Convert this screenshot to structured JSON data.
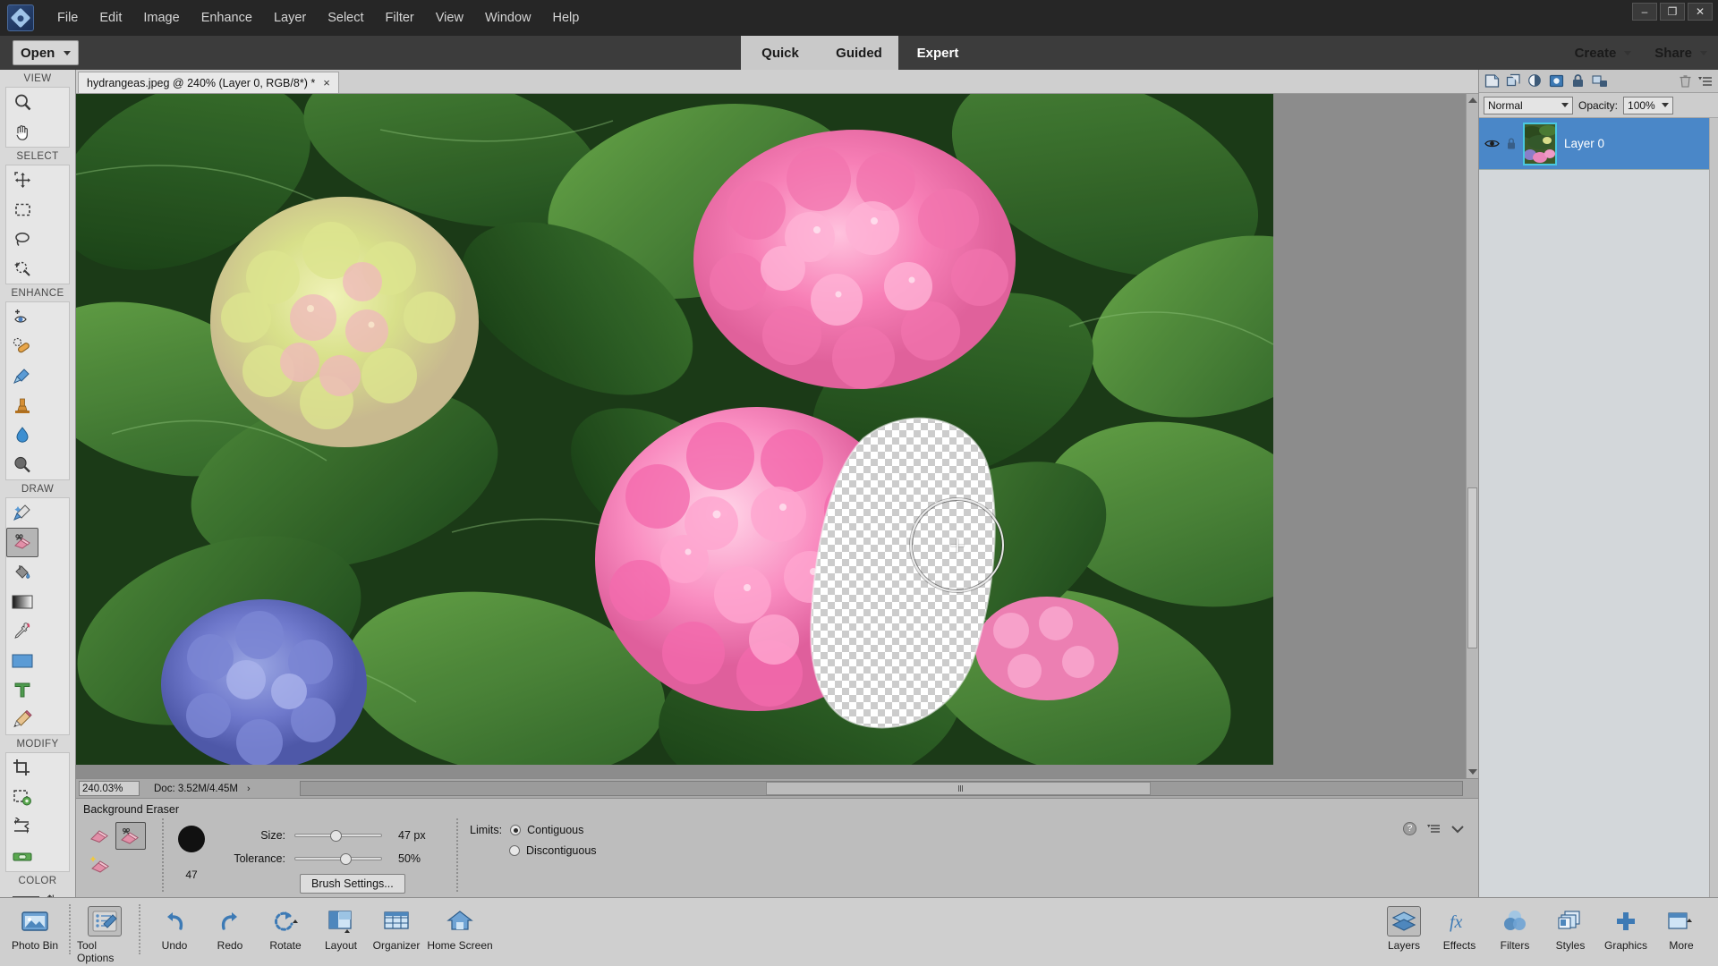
{
  "app": {
    "title": "Adobe Photoshop Elements",
    "logo_icon": "photoshop-elements-logo-icon"
  },
  "menubar": {
    "items": [
      {
        "label": "File"
      },
      {
        "label": "Edit"
      },
      {
        "label": "Image"
      },
      {
        "label": "Enhance"
      },
      {
        "label": "Layer"
      },
      {
        "label": "Select"
      },
      {
        "label": "Filter"
      },
      {
        "label": "View"
      },
      {
        "label": "Window"
      },
      {
        "label": "Help"
      }
    ],
    "window_controls": {
      "minimize": "–",
      "maximize": "❐",
      "close": "✕"
    }
  },
  "modebar": {
    "open_label": "Open",
    "modes": [
      {
        "label": "Quick",
        "active": false
      },
      {
        "label": "Guided",
        "active": false
      },
      {
        "label": "Expert",
        "active": true
      }
    ],
    "create_label": "Create",
    "share_label": "Share"
  },
  "toolbar": {
    "sections": [
      {
        "label": "VIEW",
        "tools": [
          {
            "name": "zoom-tool",
            "icon": "magnifier-icon",
            "selected": false
          },
          {
            "name": "hand-tool",
            "icon": "hand-icon",
            "selected": false
          }
        ]
      },
      {
        "label": "SELECT",
        "tools": [
          {
            "name": "move-tool",
            "icon": "move-arrows-icon",
            "selected": false
          },
          {
            "name": "rectangular-marquee-tool",
            "icon": "dashed-rectangle-icon",
            "selected": false
          },
          {
            "name": "lasso-tool",
            "icon": "lasso-icon",
            "selected": false
          },
          {
            "name": "quick-selection-tool",
            "icon": "magic-selection-icon",
            "selected": false
          }
        ]
      },
      {
        "label": "ENHANCE",
        "tools": [
          {
            "name": "red-eye-removal-tool",
            "icon": "eye-plus-icon",
            "selected": false
          },
          {
            "name": "spot-healing-brush-tool",
            "icon": "healing-bandage-icon",
            "selected": false
          },
          {
            "name": "smart-brush-tool",
            "icon": "blue-brush-icon",
            "selected": false
          },
          {
            "name": "clone-stamp-tool",
            "icon": "stamp-icon",
            "selected": false
          },
          {
            "name": "blur-tool",
            "icon": "water-drop-icon",
            "selected": false
          },
          {
            "name": "sponge-tool",
            "icon": "sponge-icon",
            "selected": false
          }
        ]
      },
      {
        "label": "DRAW",
        "tools": [
          {
            "name": "brush-tool",
            "icon": "paint-brush-icon",
            "selected": false
          },
          {
            "name": "background-eraser-tool",
            "icon": "eraser-scissors-icon",
            "selected": true
          },
          {
            "name": "paint-bucket-tool",
            "icon": "paint-bucket-icon",
            "selected": false
          },
          {
            "name": "gradient-tool",
            "icon": "gradient-swatch-icon",
            "selected": false
          },
          {
            "name": "color-picker-tool",
            "icon": "eyedropper-icon",
            "selected": false
          },
          {
            "name": "custom-shape-tool",
            "icon": "blue-rectangle-icon",
            "selected": false
          },
          {
            "name": "type-tool",
            "icon": "letter-t-icon",
            "selected": false
          },
          {
            "name": "pencil-tool",
            "icon": "pencil-icon",
            "selected": false
          }
        ]
      },
      {
        "label": "MODIFY",
        "tools": [
          {
            "name": "crop-tool",
            "icon": "crop-icon",
            "selected": false
          },
          {
            "name": "recompose-tool",
            "icon": "recompose-gear-icon",
            "selected": false
          },
          {
            "name": "content-aware-move-tool",
            "icon": "move-swap-arrows-icon",
            "selected": false
          },
          {
            "name": "straighten-tool",
            "icon": "level-bubble-icon",
            "selected": false
          }
        ]
      }
    ],
    "color_label": "COLOR",
    "foreground_color": "#000000",
    "background_color": "#ffffff"
  },
  "document": {
    "tab_title": "hydrangeas.jpeg @ 240% (Layer 0, RGB/8*) *",
    "close_glyph": "×"
  },
  "statusbar": {
    "zoom_value": "240.03%",
    "doc_info": "Doc: 3.52M/4.45M",
    "arrow_glyph": "›"
  },
  "tool_options": {
    "title": "Background Eraser",
    "modes": [
      {
        "name": "eraser-mode",
        "icon": "plain-eraser-icon",
        "selected": false
      },
      {
        "name": "background-eraser-mode",
        "icon": "eraser-scissors-icon",
        "selected": true
      },
      {
        "name": "magic-eraser-mode",
        "icon": "magic-eraser-icon",
        "selected": false
      }
    ],
    "brush_preview_value": "47",
    "size_label": "Size:",
    "size_value": "47 px",
    "size_percent": 47,
    "tolerance_label": "Tolerance:",
    "tolerance_value": "50%",
    "tolerance_percent": 50,
    "brush_settings_label": "Brush Settings...",
    "limits_label": "Limits:",
    "limits_options": [
      {
        "label": "Contiguous",
        "selected": true
      },
      {
        "label": "Discontiguous",
        "selected": false
      }
    ],
    "help_icon": "question-mark-icon",
    "menu_icon": "panel-menu-icon",
    "collapse_icon": "chevron-down-icon"
  },
  "layers_panel": {
    "toolbar_icons": [
      {
        "name": "new-layer-icon"
      },
      {
        "name": "duplicate-layer-icon"
      },
      {
        "name": "adjustment-layer-icon"
      },
      {
        "name": "layer-mask-icon"
      },
      {
        "name": "lock-layer-icon"
      },
      {
        "name": "link-layers-icon"
      },
      {
        "name": "delete-layer-trash-icon"
      },
      {
        "name": "panel-options-menu-icon"
      }
    ],
    "blend_mode": "Normal",
    "opacity_label": "Opacity:",
    "opacity_value": "100%",
    "layers": [
      {
        "name": "Layer 0",
        "visible": true,
        "selected": true,
        "visibility_icon": "eye-icon",
        "lock_icon": "lock-icon"
      }
    ]
  },
  "taskbar": {
    "left_items": [
      {
        "label": "Photo Bin",
        "icon": "photo-bin-icon",
        "selected": false
      },
      {
        "label": "Tool Options",
        "icon": "tool-options-icon",
        "selected": true
      },
      {
        "label": "Undo",
        "icon": "undo-arrow-icon",
        "selected": false
      },
      {
        "label": "Redo",
        "icon": "redo-arrow-icon",
        "selected": false
      },
      {
        "label": "Rotate",
        "icon": "rotate-icon",
        "selected": false
      },
      {
        "label": "Layout",
        "icon": "layout-grid-icon",
        "selected": false
      },
      {
        "label": "Organizer",
        "icon": "organizer-grid-icon",
        "selected": false
      },
      {
        "label": "Home Screen",
        "icon": "home-icon",
        "selected": false
      }
    ],
    "right_items": [
      {
        "label": "Layers",
        "icon": "layers-stack-icon",
        "selected": true
      },
      {
        "label": "Effects",
        "icon": "fx-icon",
        "selected": false
      },
      {
        "label": "Filters",
        "icon": "filters-circles-icon",
        "selected": false
      },
      {
        "label": "Styles",
        "icon": "styles-squares-icon",
        "selected": false
      },
      {
        "label": "Graphics",
        "icon": "plus-icon",
        "selected": false
      },
      {
        "label": "More",
        "icon": "more-panel-icon",
        "selected": false
      }
    ]
  },
  "canvas": {
    "image_name": "hydrangeas-photo",
    "erased_region_label": "transparent-erased-area",
    "brush_cursor_label": "brush-cursor-circle"
  }
}
